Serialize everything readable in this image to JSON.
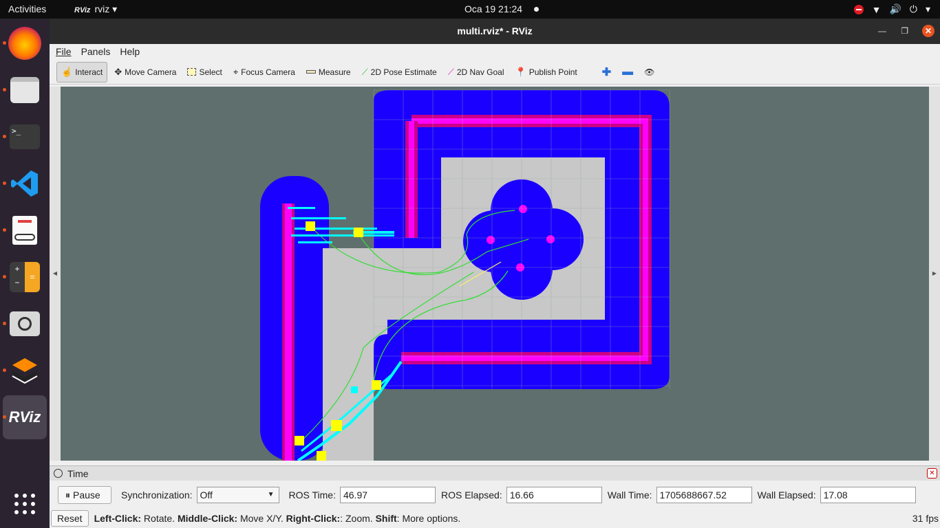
{
  "topbar": {
    "activities": "Activities",
    "app_name": "rviz",
    "app_icon_text": "RViz",
    "clock": "Oca 19  21:24"
  },
  "dock": {
    "items": [
      "Firefox",
      "Files",
      "Terminal",
      "Visual Studio Code",
      "Document Viewer",
      "Calculator",
      "Image Viewer",
      "Sublime Merge",
      "RViz",
      "Show Applications"
    ]
  },
  "window": {
    "title": "multi.rviz* - RViz"
  },
  "menu": {
    "file": "File",
    "panels": "Panels",
    "help": "Help"
  },
  "toolbar": {
    "interact": "Interact",
    "move_camera": "Move Camera",
    "select": "Select",
    "focus_camera": "Focus Camera",
    "measure": "Measure",
    "pose_estimate": "2D Pose Estimate",
    "nav_goal": "2D Nav Goal",
    "publish_point": "Publish Point"
  },
  "time_panel": {
    "title": "Time",
    "pause": "Pause",
    "sync_label": "Synchronization:",
    "sync_value": "Off",
    "ros_time_label": "ROS Time:",
    "ros_time": "46.97",
    "ros_elapsed_label": "ROS Elapsed:",
    "ros_elapsed": "16.66",
    "wall_time_label": "Wall Time:",
    "wall_time": "1705688667.52",
    "wall_elapsed_label": "Wall Elapsed:",
    "wall_elapsed": "17.08"
  },
  "status": {
    "reset": "Reset",
    "left_click": "Left-Click:",
    "left_desc": " Rotate. ",
    "middle_click": "Middle-Click:",
    "middle_desc": " Move X/Y. ",
    "right_click": "Right-Click:",
    "right_desc": ": Zoom. ",
    "shift": "Shift",
    "shift_desc": ": More options.",
    "fps": "31 fps"
  },
  "colors": {
    "costmap_inflation": "#1a00ff",
    "lethal": "#ff00ff",
    "free": "#c8c8c8",
    "background": "#5f6f6e",
    "path": "#33dd33",
    "laser": "#00ffff",
    "goal_marker": "#ffff00"
  }
}
